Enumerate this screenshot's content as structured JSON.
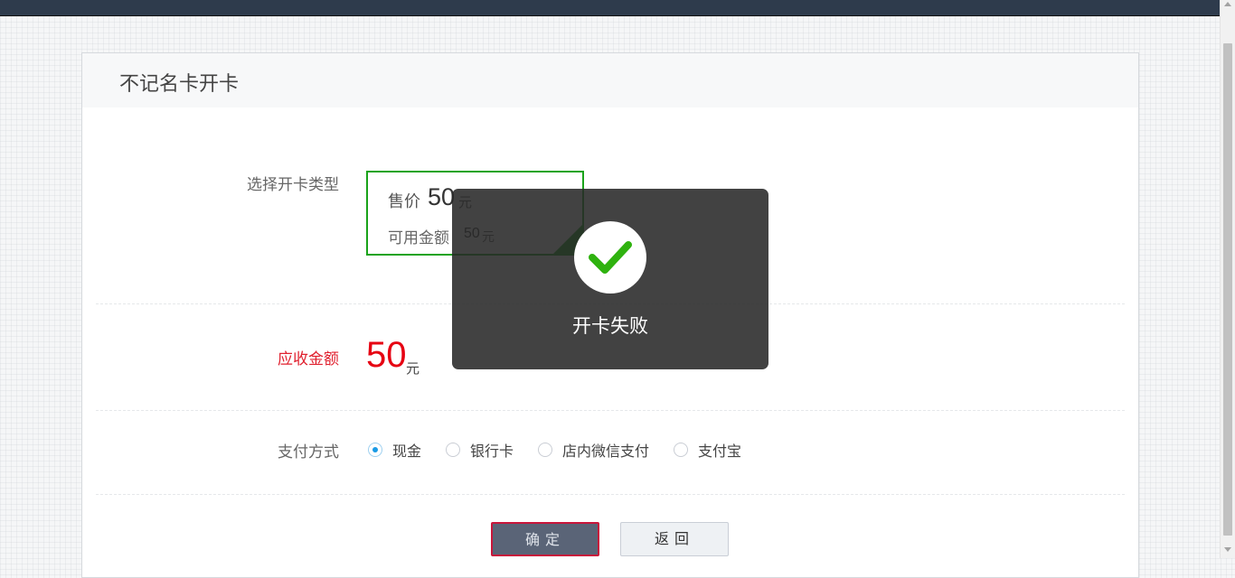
{
  "topbar": {
    "glyph": "`"
  },
  "panel": {
    "title": "不记名卡开卡"
  },
  "card_type": {
    "label": "选择开卡类型",
    "card": {
      "price_label": "售价",
      "price": "50",
      "price_unit": "元",
      "available_label": "可用金额",
      "available": "50",
      "available_unit": "元",
      "selected": true
    }
  },
  "amount_due": {
    "label": "应收金额",
    "value": "50",
    "unit": "元"
  },
  "payment": {
    "label": "支付方式",
    "options": [
      {
        "label": "现金",
        "checked": true
      },
      {
        "label": "银行卡",
        "checked": false
      },
      {
        "label": "店内微信支付",
        "checked": false
      },
      {
        "label": "支付宝",
        "checked": false
      }
    ]
  },
  "buttons": {
    "confirm": "确定",
    "back": "返回"
  },
  "toast": {
    "icon": "check-icon",
    "message": "开卡失败"
  },
  "colors": {
    "accent_green": "#1aa31a",
    "amount_red": "#e60012",
    "radio_blue": "#1a9be6"
  }
}
